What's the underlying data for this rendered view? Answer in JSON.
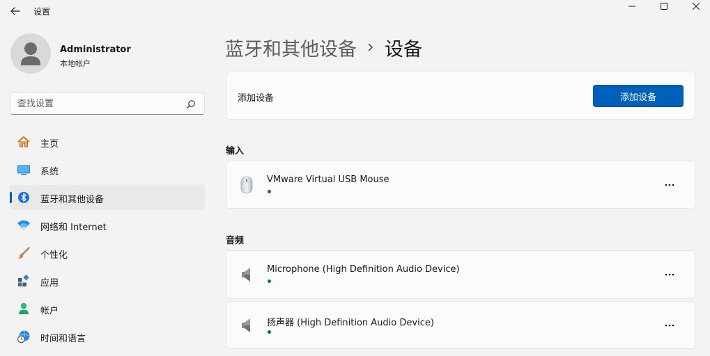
{
  "window": {
    "title": "设置"
  },
  "user": {
    "name": "Administrator",
    "account_type": "本地帐户"
  },
  "search": {
    "placeholder": "查找设置",
    "value": ""
  },
  "sidebar": {
    "items": [
      {
        "label": "主页",
        "icon": "home-icon"
      },
      {
        "label": "系统",
        "icon": "system-icon"
      },
      {
        "label": "蓝牙和其他设备",
        "icon": "bluetooth-icon",
        "active": true
      },
      {
        "label": "网络和 Internet",
        "icon": "wifi-icon"
      },
      {
        "label": "个性化",
        "icon": "brush-icon"
      },
      {
        "label": "应用",
        "icon": "apps-icon"
      },
      {
        "label": "帐户",
        "icon": "account-icon"
      },
      {
        "label": "时间和语言",
        "icon": "time-language-icon"
      }
    ]
  },
  "breadcrumb": {
    "parent": "蓝牙和其他设备",
    "current": "设备"
  },
  "add_device": {
    "label": "添加设备",
    "button_label": "添加设备"
  },
  "sections": {
    "input": {
      "title": "输入",
      "devices": [
        {
          "name": "VMware Virtual USB Mouse",
          "icon": "mouse-icon",
          "status_color": "#107c10"
        }
      ]
    },
    "audio": {
      "title": "音频",
      "devices": [
        {
          "name": "Microphone (High Definition Audio Device)",
          "icon": "speaker-icon",
          "status_color": "#107c10"
        },
        {
          "name": "扬声器 (High Definition Audio Device)",
          "icon": "speaker-icon",
          "status_color": "#107c10"
        }
      ]
    }
  },
  "colors": {
    "accent": "#005fb8",
    "connected": "#107c10"
  }
}
